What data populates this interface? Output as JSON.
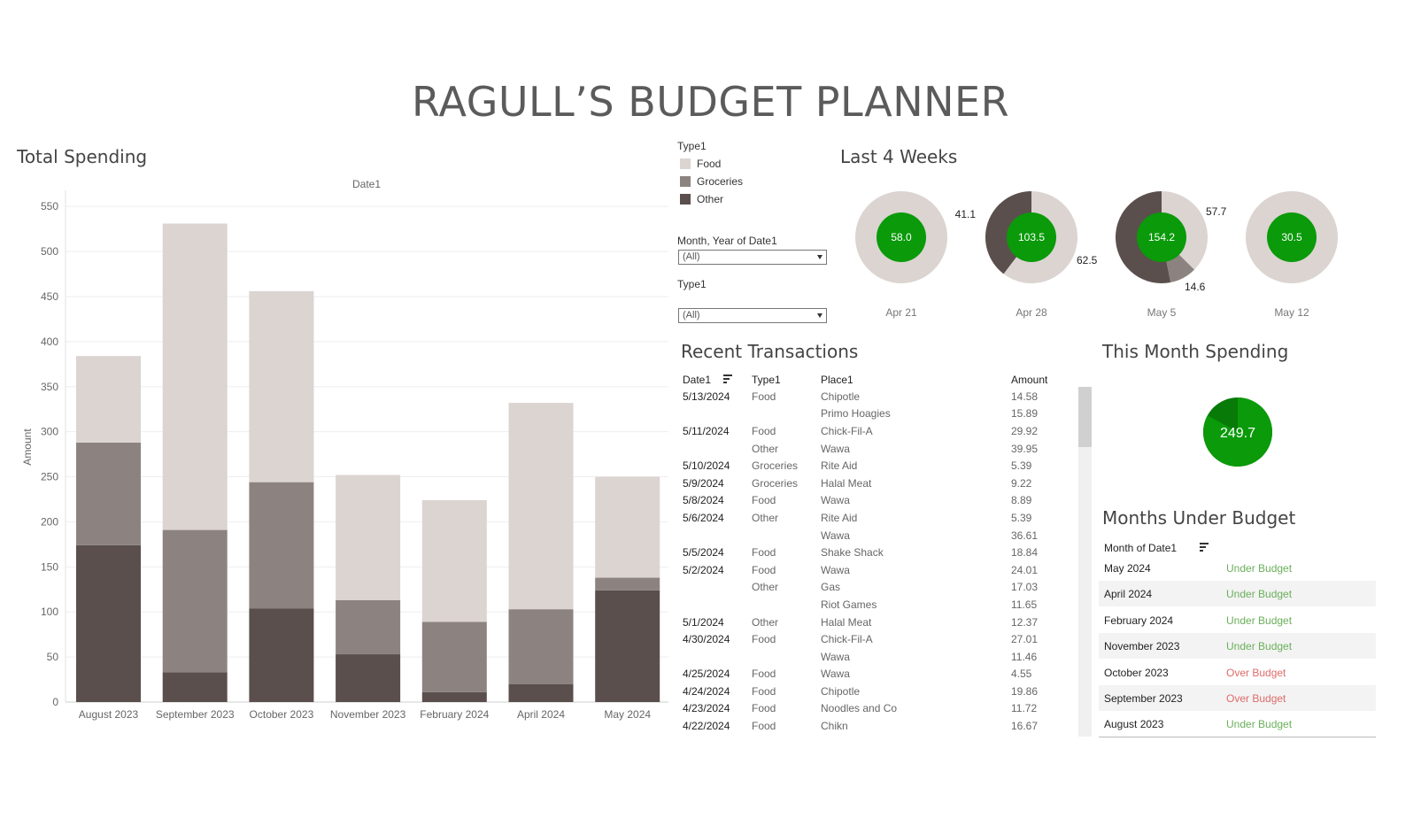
{
  "title": "RAGULL’S BUDGET PLANNER",
  "colors": {
    "food": "#dbd4d1",
    "groceries": "#8c8380",
    "other": "#5a4f4c",
    "green": "#0a9a0a",
    "dark_green": "#087a08",
    "under": "#6aaf5a",
    "over": "#e06a6a"
  },
  "total_spending": {
    "title": "Total Spending",
    "column_header": "Date1",
    "y_axis_label": "Amount",
    "y_ticks": [
      "0",
      "50",
      "100",
      "150",
      "200",
      "250",
      "300",
      "350",
      "400",
      "450",
      "500",
      "550"
    ]
  },
  "chart_data": {
    "type": "bar",
    "stacked": true,
    "categories": [
      "August 2023",
      "September 2023",
      "October 2023",
      "November 2023",
      "February 2024",
      "April 2024",
      "May 2024"
    ],
    "series": [
      {
        "name": "Other",
        "values": [
          174,
          33,
          104,
          53,
          11,
          20,
          124
        ]
      },
      {
        "name": "Groceries",
        "values": [
          114,
          158,
          140,
          60,
          78,
          83,
          14
        ]
      },
      {
        "name": "Food",
        "values": [
          96,
          340,
          212,
          139,
          135,
          229,
          112
        ]
      }
    ],
    "xlabel": "Date1",
    "ylabel": "Amount",
    "ylim": [
      0,
      560
    ]
  },
  "legend": {
    "title": "Type1",
    "items": [
      {
        "label": "Food",
        "color": "#dbd4d1"
      },
      {
        "label": "Groceries",
        "color": "#8c8380"
      },
      {
        "label": "Other",
        "color": "#5a4f4c"
      }
    ]
  },
  "filters": {
    "month": {
      "label": "Month, Year of Date1",
      "value": "(All)"
    },
    "type": {
      "label": "Type1",
      "value": "(All)"
    }
  },
  "last4": {
    "title": "Last 4 Weeks",
    "weeks": [
      {
        "label": "Apr 21",
        "total": "58.0",
        "segments": [
          {
            "type": "Food",
            "value": 58.0
          }
        ],
        "outer_labels": []
      },
      {
        "label": "Apr 28",
        "total": "103.5",
        "segments": [
          {
            "type": "Food",
            "value": 62.5
          },
          {
            "type": "Other",
            "value": 41.1
          }
        ],
        "outer_labels": [
          "41.1",
          "62.5"
        ]
      },
      {
        "label": "May 5",
        "total": "154.2",
        "segments": [
          {
            "type": "Food",
            "value": 57.7
          },
          {
            "type": "Groceries",
            "value": 14.6
          },
          {
            "type": "Other",
            "value": 81.9
          }
        ],
        "outer_labels": [
          "57.7",
          "14.6"
        ]
      },
      {
        "label": "May 12",
        "total": "30.5",
        "segments": [
          {
            "type": "Food",
            "value": 30.5
          }
        ],
        "outer_labels": []
      }
    ]
  },
  "recent": {
    "title": "Recent Transactions",
    "headers": {
      "date": "Date1",
      "type": "Type1",
      "place": "Place1",
      "amount": "Amount"
    },
    "rows": [
      {
        "date": "5/13/2024",
        "type": "Food",
        "place": "Chipotle",
        "amount": "14.58"
      },
      {
        "date": "",
        "type": "",
        "place": "Primo Hoagies",
        "amount": "15.89"
      },
      {
        "date": "5/11/2024",
        "type": "Food",
        "place": "Chick-Fil-A",
        "amount": "29.92"
      },
      {
        "date": "",
        "type": "Other",
        "place": "Wawa",
        "amount": "39.95"
      },
      {
        "date": "5/10/2024",
        "type": "Groceries",
        "place": "Rite Aid",
        "amount": "5.39"
      },
      {
        "date": "5/9/2024",
        "type": "Groceries",
        "place": "Halal Meat",
        "amount": "9.22"
      },
      {
        "date": "5/8/2024",
        "type": "Food",
        "place": "Wawa",
        "amount": "8.89"
      },
      {
        "date": "5/6/2024",
        "type": "Other",
        "place": "Rite Aid",
        "amount": "5.39"
      },
      {
        "date": "",
        "type": "",
        "place": "Wawa",
        "amount": "36.61"
      },
      {
        "date": "5/5/2024",
        "type": "Food",
        "place": "Shake Shack",
        "amount": "18.84"
      },
      {
        "date": "5/2/2024",
        "type": "Food",
        "place": "Wawa",
        "amount": "24.01"
      },
      {
        "date": "",
        "type": "Other",
        "place": "Gas",
        "amount": "17.03"
      },
      {
        "date": "",
        "type": "",
        "place": "Riot Games",
        "amount": "11.65"
      },
      {
        "date": "5/1/2024",
        "type": "Other",
        "place": "Halal Meat",
        "amount": "12.37"
      },
      {
        "date": "4/30/2024",
        "type": "Food",
        "place": "Chick-Fil-A",
        "amount": "27.01"
      },
      {
        "date": "",
        "type": "",
        "place": "Wawa",
        "amount": "11.46"
      },
      {
        "date": "4/25/2024",
        "type": "Food",
        "place": "Wawa",
        "amount": "4.55"
      },
      {
        "date": "4/24/2024",
        "type": "Food",
        "place": "Chipotle",
        "amount": "19.86"
      },
      {
        "date": "4/23/2024",
        "type": "Food",
        "place": "Noodles and Co",
        "amount": "11.72"
      },
      {
        "date": "4/22/2024",
        "type": "Food",
        "place": "Chikn",
        "amount": "16.67"
      }
    ]
  },
  "this_month": {
    "title": "This Month Spending",
    "value": "249.7",
    "budget_fraction": 0.83
  },
  "months_under": {
    "title": "Months Under Budget",
    "header": "Month of Date1",
    "rows": [
      {
        "month": "May 2024",
        "status": "Under Budget",
        "over": false
      },
      {
        "month": "April 2024",
        "status": "Under Budget",
        "over": false
      },
      {
        "month": "February 2024",
        "status": "Under Budget",
        "over": false
      },
      {
        "month": "November 2023",
        "status": "Under Budget",
        "over": false
      },
      {
        "month": "October 2023",
        "status": "Over Budget",
        "over": true
      },
      {
        "month": "September 2023",
        "status": "Over Budget",
        "over": true
      },
      {
        "month": "August 2023",
        "status": "Under Budget",
        "over": false
      }
    ]
  }
}
